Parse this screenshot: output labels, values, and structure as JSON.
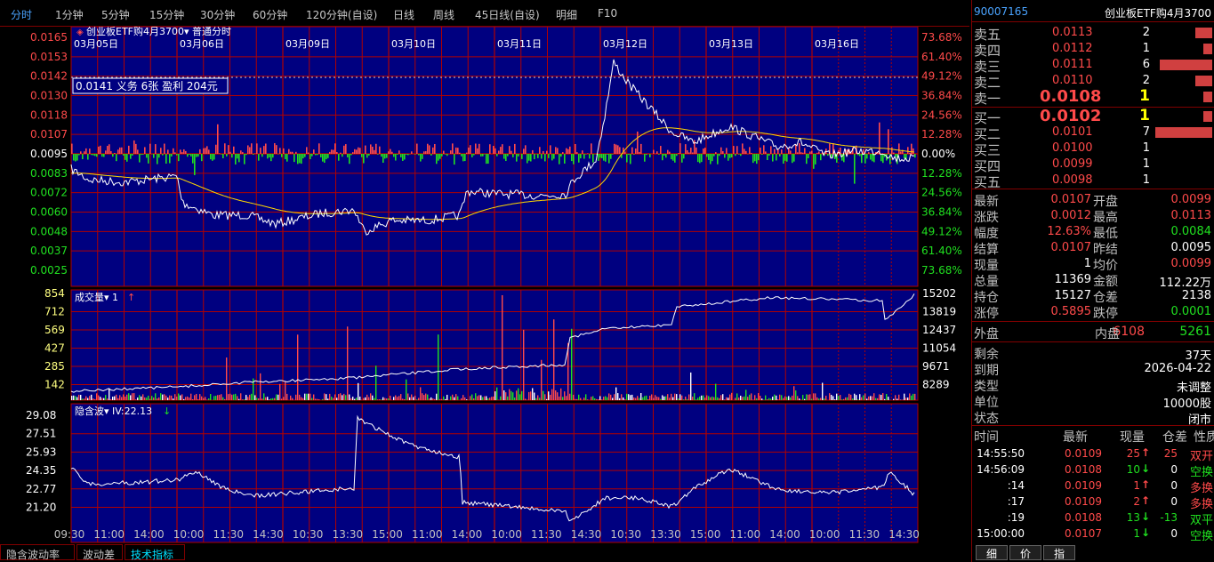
{
  "toolbar": {
    "items": [
      "分时",
      "1分钟",
      "5分钟",
      "15分钟",
      "30分钟",
      "60分钟",
      "120分钟(自设)",
      "日线",
      "周线",
      "45日线(自设)",
      "明细",
      "F10"
    ]
  },
  "main_chart": {
    "title": "创业板ETF购4月3700",
    "mode": "普通分时",
    "dates": [
      "03月05日",
      "03月06日",
      "03月09日",
      "03月10日",
      "03月11日",
      "03月12日",
      "03月13日",
      "03月16日"
    ],
    "price_ticks": [
      "0.0165",
      "0.0153",
      "0.0142",
      "0.0130",
      "0.0118",
      "0.0107",
      "0.0095",
      "0.0083",
      "0.0072",
      "0.0060",
      "0.0048",
      "0.0037",
      "0.0025"
    ],
    "pct_ticks": [
      "73.68%",
      "61.40%",
      "49.12%",
      "36.84%",
      "24.56%",
      "12.28%",
      "0.00%",
      "12.28%",
      "24.56%",
      "36.84%",
      "49.12%",
      "61.40%",
      "73.68%"
    ],
    "info_box": "0.0141 义务  6张  盈利  204元"
  },
  "volume_chart": {
    "title": "成交量",
    "param": "1",
    "left_ticks": [
      "854",
      "712",
      "569",
      "427",
      "285",
      "142"
    ],
    "right_ticks": [
      "15202",
      "13819",
      "12437",
      "11054",
      "9671",
      "8289"
    ]
  },
  "iv_chart": {
    "title": "隐含波",
    "param": "IV:22.13",
    "ticks": [
      "29.08",
      "27.51",
      "25.93",
      "24.35",
      "22.77",
      "21.20"
    ]
  },
  "time_axis": [
    "09:30",
    "11:00",
    "14:00",
    "10:00",
    "11:30",
    "14:30",
    "10:30",
    "13:30",
    "15:00",
    "11:00",
    "14:00",
    "10:00",
    "11:30",
    "14:30",
    "10:30",
    "13:30",
    "15:00",
    "11:00",
    "14:00",
    "10:00",
    "11:30",
    "14:30"
  ],
  "bottom_tabs": [
    "隐含波动率",
    "波动差",
    "技术指标"
  ],
  "right_panel": {
    "code": "90007165",
    "name": "创业板ETF购4月3700",
    "asks": [
      {
        "label": "卖五",
        "price": "0.0113",
        "qty": "2",
        "bar": 0.3
      },
      {
        "label": "卖四",
        "price": "0.0112",
        "qty": "1",
        "bar": 0.15
      },
      {
        "label": "卖三",
        "price": "0.0111",
        "qty": "6",
        "bar": 0.92
      },
      {
        "label": "卖二",
        "price": "0.0110",
        "qty": "2",
        "bar": 0.3
      },
      {
        "label": "卖一",
        "price": "0.0108",
        "qty": "1",
        "bar": 0.15
      }
    ],
    "bids": [
      {
        "label": "买一",
        "price": "0.0102",
        "qty": "1",
        "bar": 0.15
      },
      {
        "label": "买二",
        "price": "0.0101",
        "qty": "7",
        "bar": 1.0
      },
      {
        "label": "买三",
        "price": "0.0100",
        "qty": "1",
        "bar": 0
      },
      {
        "label": "买四",
        "price": "0.0099",
        "qty": "1",
        "bar": 0
      },
      {
        "label": "买五",
        "price": "0.0098",
        "qty": "1",
        "bar": 0
      }
    ],
    "stats": [
      {
        "l1": "最新",
        "v1": "0.0107",
        "c1": "red",
        "l2": "开盘",
        "v2": "0.0099",
        "c2": "red"
      },
      {
        "l1": "涨跌",
        "v1": "0.0012",
        "c1": "red",
        "l2": "最高",
        "v2": "0.0113",
        "c2": "red"
      },
      {
        "l1": "幅度",
        "v1": "12.63%",
        "c1": "red",
        "l2": "最低",
        "v2": "0.0084",
        "c2": "grn"
      },
      {
        "l1": "结算",
        "v1": "0.0107",
        "c1": "red",
        "l2": "昨结",
        "v2": "0.0095",
        "c2": "wht"
      },
      {
        "l1": "现量",
        "v1": "1",
        "c1": "wht",
        "l2": "均价",
        "v2": "0.0099",
        "c2": "red"
      },
      {
        "l1": "总量",
        "v1": "11369",
        "c1": "wht",
        "l2": "金额",
        "v2": "112.22万",
        "c2": "wht"
      },
      {
        "l1": "持仓",
        "v1": "15127",
        "c1": "wht",
        "l2": "仓差",
        "v2": "2138",
        "c2": "wht"
      },
      {
        "l1": "涨停",
        "v1": "0.5895",
        "c1": "red",
        "l2": "跌停",
        "v2": "0.0001",
        "c2": "grn"
      }
    ],
    "waipan_label": "外盘",
    "waipan": "6108",
    "neipan_label": "内盘",
    "neipan": "5261",
    "info": [
      {
        "label": "剩余",
        "value": "37天"
      },
      {
        "label": "到期",
        "value": "2026-04-22"
      },
      {
        "label": "类型",
        "value": "未调整"
      },
      {
        "label": "单位",
        "value": "10000股"
      },
      {
        "label": "状态",
        "value": "闭市"
      }
    ],
    "tick_headers": [
      "时间",
      "最新",
      "现量",
      "仓差",
      "性质"
    ],
    "ticks": [
      {
        "time": "14:55:50",
        "price": "0.0109",
        "vol": "25",
        "dir": "up",
        "oi": "25",
        "nature": "双开",
        "nc": "red"
      },
      {
        "time": "14:56:09",
        "price": "0.0108",
        "vol": "10",
        "dir": "down",
        "oi": "0",
        "nature": "空换",
        "nc": "grn"
      },
      {
        "time": ":14",
        "price": "0.0109",
        "vol": "1",
        "dir": "up",
        "oi": "0",
        "nature": "多换",
        "nc": "red"
      },
      {
        "time": ":17",
        "price": "0.0109",
        "vol": "2",
        "dir": "up",
        "oi": "0",
        "nature": "多换",
        "nc": "red"
      },
      {
        "time": ":19",
        "price": "0.0108",
        "vol": "13",
        "dir": "down",
        "oi": "-13",
        "nature": "双平",
        "nc": "grn"
      },
      {
        "time": "15:00:00",
        "price": "0.0107",
        "vol": "1",
        "dir": "down",
        "oi": "0",
        "nature": "空换",
        "nc": "grn"
      }
    ],
    "tabs": [
      "细",
      "价",
      "指"
    ]
  },
  "colors": {
    "bg": "#000000",
    "panel": "#000080",
    "grid": "#b00000",
    "up": "#ff4a4a",
    "down": "#20e020",
    "line": "#ffffff",
    "avg": "#ffd700"
  }
}
